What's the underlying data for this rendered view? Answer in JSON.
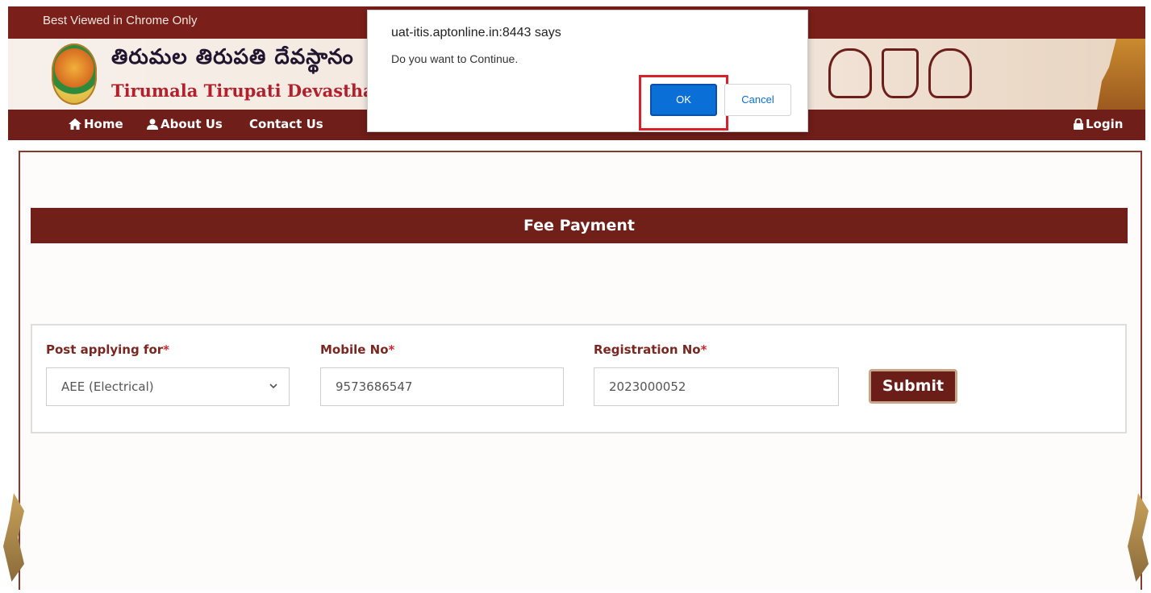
{
  "topbar": {
    "notice": "Best Viewed in Chrome Only"
  },
  "banner": {
    "telugu_title": "తిరుమల తిరుపతి దేవస్థానం",
    "english_title": "Tirumala Tirupati Devasthar"
  },
  "nav": {
    "home": "Home",
    "about": "About Us",
    "contact": "Contact Us",
    "login": "Login"
  },
  "page": {
    "heading": "Fee Payment"
  },
  "form": {
    "post_label": "Post applying for",
    "post_value": "AEE (Electrical)",
    "mobile_label": "Mobile No",
    "mobile_value": "9573686547",
    "registration_label": "Registration No",
    "registration_value": "2023000052",
    "required_mark": "*",
    "submit_label": "Submit"
  },
  "dialog": {
    "origin": "uat-itis.aptonline.in:8443 says",
    "message": "Do you want to Continue.",
    "ok_label": "OK",
    "cancel_label": "Cancel"
  },
  "colors": {
    "maroon": "#701f19",
    "label": "#7b2620",
    "required": "#d8262b",
    "ok_blue": "#0b6fd8",
    "highlight_red": "#d9202b"
  }
}
